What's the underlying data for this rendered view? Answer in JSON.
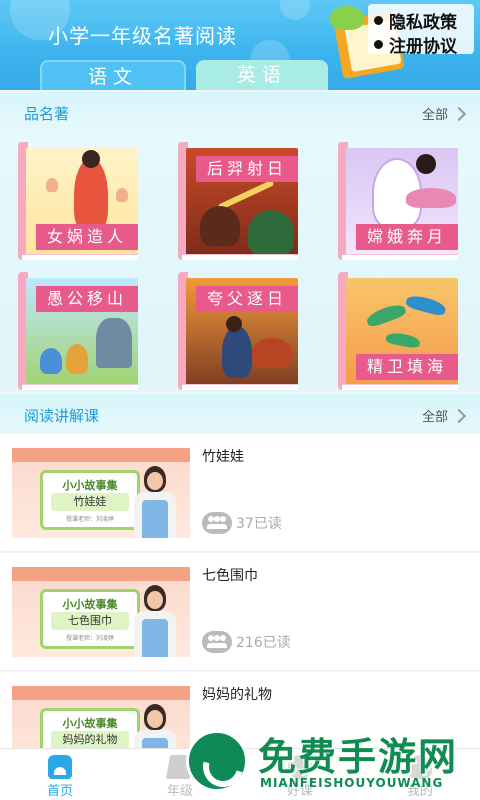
{
  "header": {
    "title": "小学一年级名著阅读",
    "links": [
      "隐私政策",
      "注册协议"
    ],
    "tabs": [
      {
        "label": "语文"
      },
      {
        "label": "英语"
      }
    ]
  },
  "classics": {
    "title": "品名著",
    "more_label": "全部",
    "books": [
      {
        "title": "女娲造人"
      },
      {
        "title": "后羿射日"
      },
      {
        "title": "嫦娥奔月"
      },
      {
        "title": "愚公移山"
      },
      {
        "title": "夸父逐日"
      },
      {
        "title": "精卫填海"
      }
    ]
  },
  "lectures": {
    "title": "阅读讲解课",
    "more_label": "全部",
    "thumb_header": "小小故事集",
    "thumb_teacher": "授课老师：刘凌婷",
    "items": [
      {
        "title": "竹娃娃",
        "reads": "37已读"
      },
      {
        "title": "七色围巾",
        "reads": "216已读"
      },
      {
        "title": "妈妈的礼物",
        "reads": ""
      }
    ]
  },
  "bottom_nav": {
    "items": [
      {
        "label": "首页",
        "icon": "home-icon"
      },
      {
        "label": "年级",
        "icon": "grade-icon"
      },
      {
        "label": "好课",
        "icon": "course-icon"
      },
      {
        "label": "我的",
        "icon": "profile-icon"
      }
    ]
  },
  "watermark": {
    "title": "免费手游网",
    "subtitle": "MIANFEISHOUYOUWANG"
  },
  "colors": {
    "header_blue": "#3cb4ee",
    "accent_pink": "#e85a8b",
    "section_blue": "#1a9cd8",
    "nav_active": "#2aa7e6",
    "watermark_green": "#108c52"
  }
}
